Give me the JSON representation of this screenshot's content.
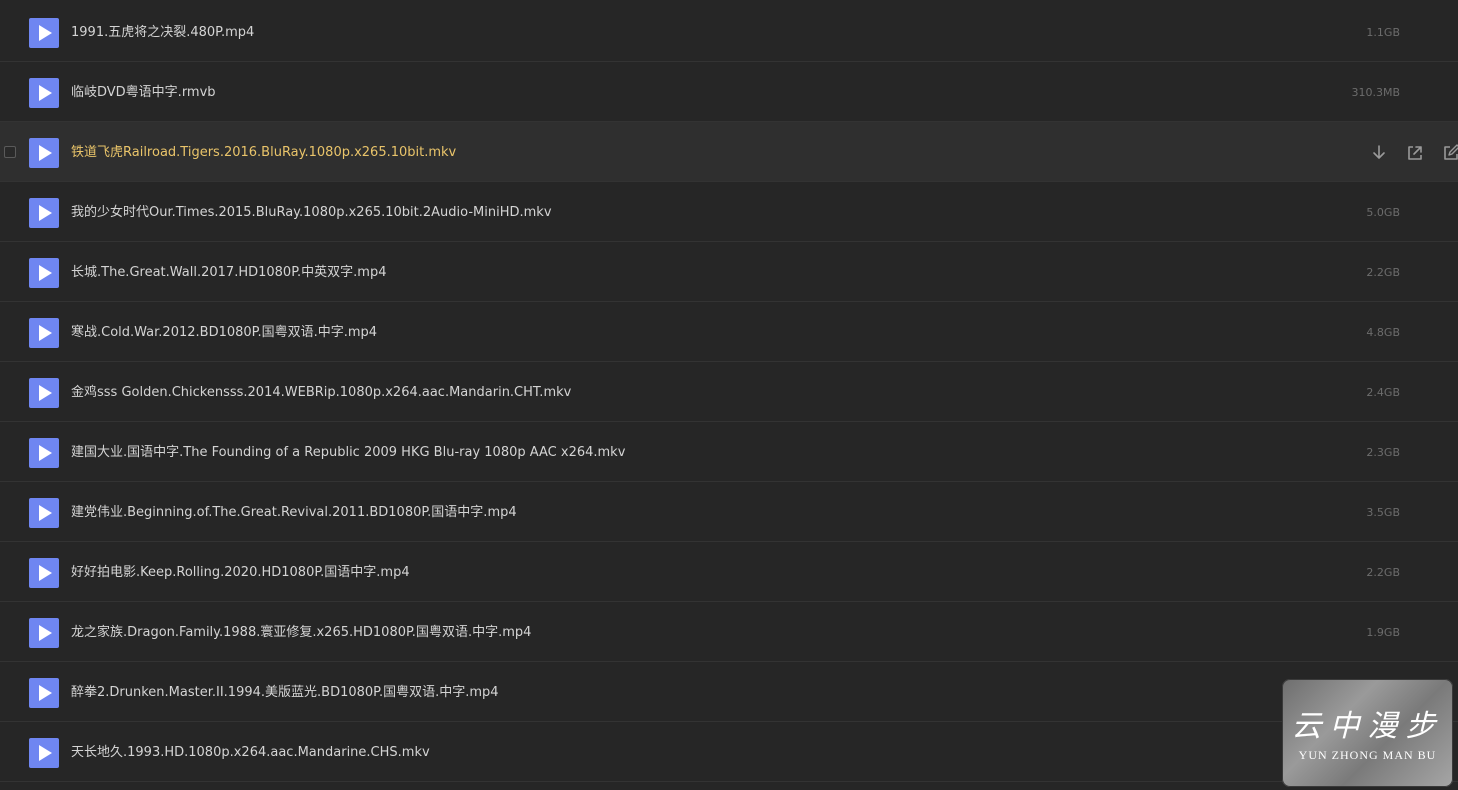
{
  "files": [
    {
      "name": "1991.五虎将之决裂.480P.mp4",
      "size": "1.1GB"
    },
    {
      "name": "临岐DVD粤语中字.rmvb",
      "size": "310.3MB"
    },
    {
      "name": "铁道飞虎Railroad.Tigers.2016.BluRay.1080p.x265.10bit.mkv",
      "size": ""
    },
    {
      "name": "我的少女时代Our.Times.2015.BluRay.1080p.x265.10bit.2Audio-MiniHD.mkv",
      "size": "5.0GB"
    },
    {
      "name": "长城.The.Great.Wall.2017.HD1080P.中英双字.mp4",
      "size": "2.2GB"
    },
    {
      "name": "寒战.Cold.War.2012.BD1080P.国粤双语.中字.mp4",
      "size": "4.8GB"
    },
    {
      "name": "金鸡sss Golden.Chickensss.2014.WEBRip.1080p.x264.aac.Mandarin.CHT.mkv",
      "size": "2.4GB"
    },
    {
      "name": "建国大业.国语中字.The Founding of a Republic 2009 HKG Blu-ray 1080p AAC x264.mkv",
      "size": "2.3GB"
    },
    {
      "name": "建党伟业.Beginning.of.The.Great.Revival.2011.BD1080P.国语中字.mp4",
      "size": "3.5GB"
    },
    {
      "name": "好好拍电影.Keep.Rolling.2020.HD1080P.国语中字.mp4",
      "size": "2.2GB"
    },
    {
      "name": "龙之家族.Dragon.Family.1988.寰亚修复.x265.HD1080P.国粤双语.中字.mp4",
      "size": "1.9GB"
    },
    {
      "name": "醉拳2.Drunken.Master.II.1994.美版蓝光.BD1080P.国粤双语.中字.mp4",
      "size": ""
    },
    {
      "name": "天长地久.1993.HD.1080p.x264.aac.Mandarine.CHS.mkv",
      "size": ""
    }
  ],
  "active_index": 2,
  "row_actions": [
    "download-icon",
    "share-icon",
    "rename-icon"
  ],
  "watermark": {
    "chinese": "云中漫步",
    "english": "YUN ZHONG MAN BU"
  },
  "colors": {
    "background": "#262626",
    "play_icon": "#6f86f1",
    "active_name": "#e9c46a",
    "name": "#d4d4d4",
    "size": "#6c6c6c"
  }
}
